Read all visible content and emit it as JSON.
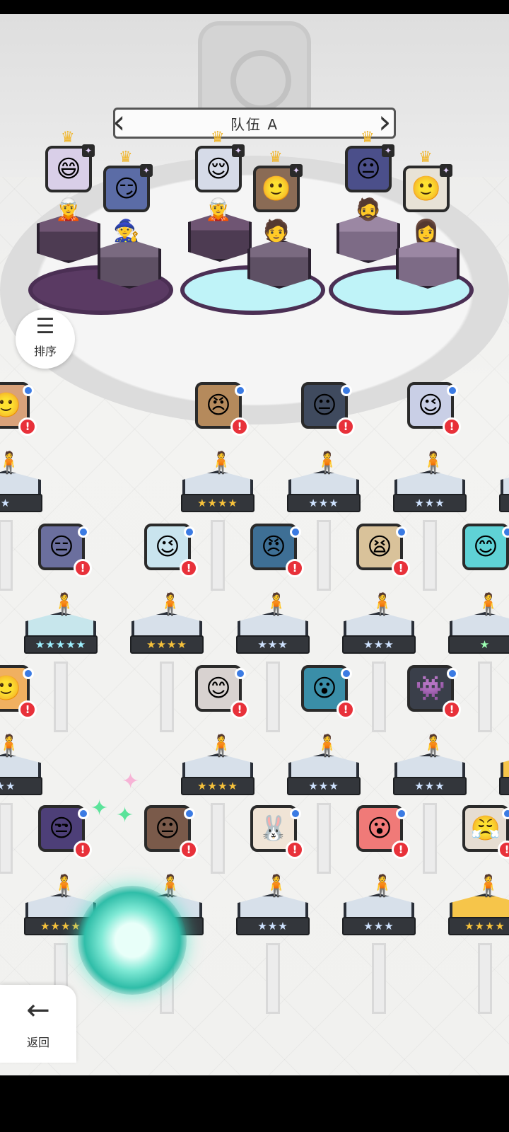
{
  "team": {
    "title": "队伍 A"
  },
  "buttons": {
    "sort": "排序",
    "back": "返回"
  },
  "icons": {
    "sort": "sort-icon",
    "back": "arrow-left-icon",
    "alert": "exclamation-icon",
    "crown": "crown-icon"
  },
  "colors": {
    "alert": "#e8313a",
    "badge_blue": "#3b7be3",
    "pad_purple": "#5a3a63",
    "pad_cyan": "#bff3f8",
    "gold": "#f6c54a"
  },
  "team_slots": [
    {
      "face": "😄",
      "portrait_bg": "#d9cfe8",
      "sprite": "🧝",
      "crowned": true
    },
    {
      "face": "😏",
      "portrait_bg": "#5b6ca6",
      "sprite": "🧙",
      "crowned": true
    },
    {
      "face": "😌",
      "portrait_bg": "#d6dbe8",
      "sprite": "🧝",
      "crowned": true
    },
    {
      "face": "🙂",
      "portrait_bg": "#8a6b55",
      "sprite": "🧑",
      "crowned": true
    },
    {
      "face": "😐",
      "portrait_bg": "#4b4f8a",
      "sprite": "🧔",
      "crowned": true
    },
    {
      "face": "🙂",
      "portrait_bg": "#e8e2d6",
      "sprite": "👩",
      "crowned": true
    }
  ],
  "roster_rows": [
    [
      {
        "face": "🙂",
        "bg": "#d9a27a",
        "stars": "★",
        "stand": "plain",
        "partial": true
      },
      {
        "face": "😠",
        "bg": "#b58a5c",
        "stars": "★★★★",
        "stand": "plain",
        "rank": "gold"
      },
      {
        "face": "😐",
        "bg": "#3f4a5e",
        "stars": "★★★",
        "stand": "plain",
        "rank": "blue"
      },
      {
        "face": "😉",
        "bg": "#c9cfe6",
        "stars": "★★★",
        "stand": "plain",
        "rank": "blue"
      },
      {
        "face": "😉",
        "bg": "#3d6b5a",
        "stars": "★★★",
        "stand": "plain",
        "rank": "blue"
      }
    ],
    [
      {
        "face": "😑",
        "bg": "#6b6f9e",
        "stars": "★★★★★",
        "stand": "teal",
        "rank": "rainbow"
      },
      {
        "face": "😉",
        "bg": "#c9e4ee",
        "stars": "★★★★",
        "stand": "plain",
        "rank": "gold"
      },
      {
        "face": "😠",
        "bg": "#3e6f95",
        "stars": "★★★",
        "stand": "plain",
        "rank": "blue"
      },
      {
        "face": "😫",
        "bg": "#d9c29a",
        "stars": "★★★",
        "stand": "plain",
        "rank": "blue"
      },
      {
        "face": "😊",
        "bg": "#5fd2d6",
        "stars": "★",
        "stand": "plain",
        "rank": "green"
      }
    ],
    [
      {
        "face": "🙂",
        "bg": "#f0b060",
        "stars": "★★",
        "stand": "plain",
        "partial": true
      },
      {
        "face": "😊",
        "bg": "#d8d2d0",
        "stars": "★★★★",
        "stand": "plain",
        "rank": "gold"
      },
      {
        "face": "😮",
        "bg": "#3a8ea8",
        "stars": "★★★",
        "stand": "plain",
        "rank": "blue"
      },
      {
        "face": "👾",
        "bg": "#3a3f4a",
        "stars": "★★★",
        "stand": "plain",
        "rank": "blue"
      },
      {
        "face": "🤖",
        "bg": "#2e3a35",
        "stars": "★★★★",
        "stand": "gold",
        "rank": "gold"
      }
    ],
    [
      {
        "face": "😒",
        "bg": "#4d3f78",
        "stars": "★★★★",
        "stand": "plain",
        "rank": "gold"
      },
      {
        "face": "😐",
        "bg": "#7a5a4a",
        "stars": "★★",
        "stand": "plain",
        "rank": "blue"
      },
      {
        "face": "🐰",
        "bg": "#f0e4d6",
        "stars": "★★★",
        "stand": "plain",
        "rank": "blue"
      },
      {
        "face": "😮",
        "bg": "#f07a78",
        "stars": "★★★",
        "stand": "plain",
        "rank": "blue"
      },
      {
        "face": "😤",
        "bg": "#e6ddd2",
        "stars": "★★★★",
        "stand": "gold",
        "rank": "gold"
      }
    ]
  ]
}
